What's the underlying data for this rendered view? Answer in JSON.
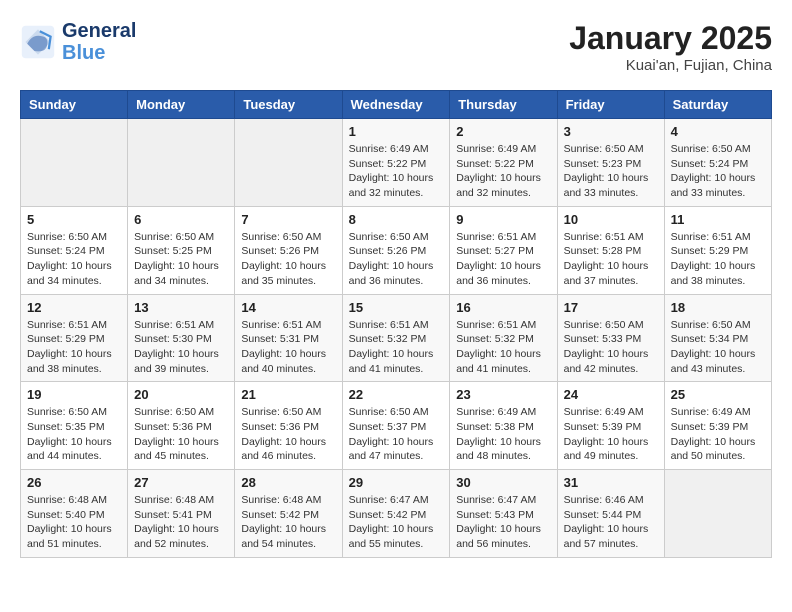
{
  "header": {
    "logo_line1": "General",
    "logo_line2": "Blue",
    "month_title": "January 2025",
    "location": "Kuai'an, Fujian, China"
  },
  "days_of_week": [
    "Sunday",
    "Monday",
    "Tuesday",
    "Wednesday",
    "Thursday",
    "Friday",
    "Saturday"
  ],
  "weeks": [
    [
      {
        "day": "",
        "info": ""
      },
      {
        "day": "",
        "info": ""
      },
      {
        "day": "",
        "info": ""
      },
      {
        "day": "1",
        "info": "Sunrise: 6:49 AM\nSunset: 5:22 PM\nDaylight: 10 hours\nand 32 minutes."
      },
      {
        "day": "2",
        "info": "Sunrise: 6:49 AM\nSunset: 5:22 PM\nDaylight: 10 hours\nand 32 minutes."
      },
      {
        "day": "3",
        "info": "Sunrise: 6:50 AM\nSunset: 5:23 PM\nDaylight: 10 hours\nand 33 minutes."
      },
      {
        "day": "4",
        "info": "Sunrise: 6:50 AM\nSunset: 5:24 PM\nDaylight: 10 hours\nand 33 minutes."
      }
    ],
    [
      {
        "day": "5",
        "info": "Sunrise: 6:50 AM\nSunset: 5:24 PM\nDaylight: 10 hours\nand 34 minutes."
      },
      {
        "day": "6",
        "info": "Sunrise: 6:50 AM\nSunset: 5:25 PM\nDaylight: 10 hours\nand 34 minutes."
      },
      {
        "day": "7",
        "info": "Sunrise: 6:50 AM\nSunset: 5:26 PM\nDaylight: 10 hours\nand 35 minutes."
      },
      {
        "day": "8",
        "info": "Sunrise: 6:50 AM\nSunset: 5:26 PM\nDaylight: 10 hours\nand 36 minutes."
      },
      {
        "day": "9",
        "info": "Sunrise: 6:51 AM\nSunset: 5:27 PM\nDaylight: 10 hours\nand 36 minutes."
      },
      {
        "day": "10",
        "info": "Sunrise: 6:51 AM\nSunset: 5:28 PM\nDaylight: 10 hours\nand 37 minutes."
      },
      {
        "day": "11",
        "info": "Sunrise: 6:51 AM\nSunset: 5:29 PM\nDaylight: 10 hours\nand 38 minutes."
      }
    ],
    [
      {
        "day": "12",
        "info": "Sunrise: 6:51 AM\nSunset: 5:29 PM\nDaylight: 10 hours\nand 38 minutes."
      },
      {
        "day": "13",
        "info": "Sunrise: 6:51 AM\nSunset: 5:30 PM\nDaylight: 10 hours\nand 39 minutes."
      },
      {
        "day": "14",
        "info": "Sunrise: 6:51 AM\nSunset: 5:31 PM\nDaylight: 10 hours\nand 40 minutes."
      },
      {
        "day": "15",
        "info": "Sunrise: 6:51 AM\nSunset: 5:32 PM\nDaylight: 10 hours\nand 41 minutes."
      },
      {
        "day": "16",
        "info": "Sunrise: 6:51 AM\nSunset: 5:32 PM\nDaylight: 10 hours\nand 41 minutes."
      },
      {
        "day": "17",
        "info": "Sunrise: 6:50 AM\nSunset: 5:33 PM\nDaylight: 10 hours\nand 42 minutes."
      },
      {
        "day": "18",
        "info": "Sunrise: 6:50 AM\nSunset: 5:34 PM\nDaylight: 10 hours\nand 43 minutes."
      }
    ],
    [
      {
        "day": "19",
        "info": "Sunrise: 6:50 AM\nSunset: 5:35 PM\nDaylight: 10 hours\nand 44 minutes."
      },
      {
        "day": "20",
        "info": "Sunrise: 6:50 AM\nSunset: 5:36 PM\nDaylight: 10 hours\nand 45 minutes."
      },
      {
        "day": "21",
        "info": "Sunrise: 6:50 AM\nSunset: 5:36 PM\nDaylight: 10 hours\nand 46 minutes."
      },
      {
        "day": "22",
        "info": "Sunrise: 6:50 AM\nSunset: 5:37 PM\nDaylight: 10 hours\nand 47 minutes."
      },
      {
        "day": "23",
        "info": "Sunrise: 6:49 AM\nSunset: 5:38 PM\nDaylight: 10 hours\nand 48 minutes."
      },
      {
        "day": "24",
        "info": "Sunrise: 6:49 AM\nSunset: 5:39 PM\nDaylight: 10 hours\nand 49 minutes."
      },
      {
        "day": "25",
        "info": "Sunrise: 6:49 AM\nSunset: 5:39 PM\nDaylight: 10 hours\nand 50 minutes."
      }
    ],
    [
      {
        "day": "26",
        "info": "Sunrise: 6:48 AM\nSunset: 5:40 PM\nDaylight: 10 hours\nand 51 minutes."
      },
      {
        "day": "27",
        "info": "Sunrise: 6:48 AM\nSunset: 5:41 PM\nDaylight: 10 hours\nand 52 minutes."
      },
      {
        "day": "28",
        "info": "Sunrise: 6:48 AM\nSunset: 5:42 PM\nDaylight: 10 hours\nand 54 minutes."
      },
      {
        "day": "29",
        "info": "Sunrise: 6:47 AM\nSunset: 5:42 PM\nDaylight: 10 hours\nand 55 minutes."
      },
      {
        "day": "30",
        "info": "Sunrise: 6:47 AM\nSunset: 5:43 PM\nDaylight: 10 hours\nand 56 minutes."
      },
      {
        "day": "31",
        "info": "Sunrise: 6:46 AM\nSunset: 5:44 PM\nDaylight: 10 hours\nand 57 minutes."
      },
      {
        "day": "",
        "info": ""
      }
    ]
  ]
}
